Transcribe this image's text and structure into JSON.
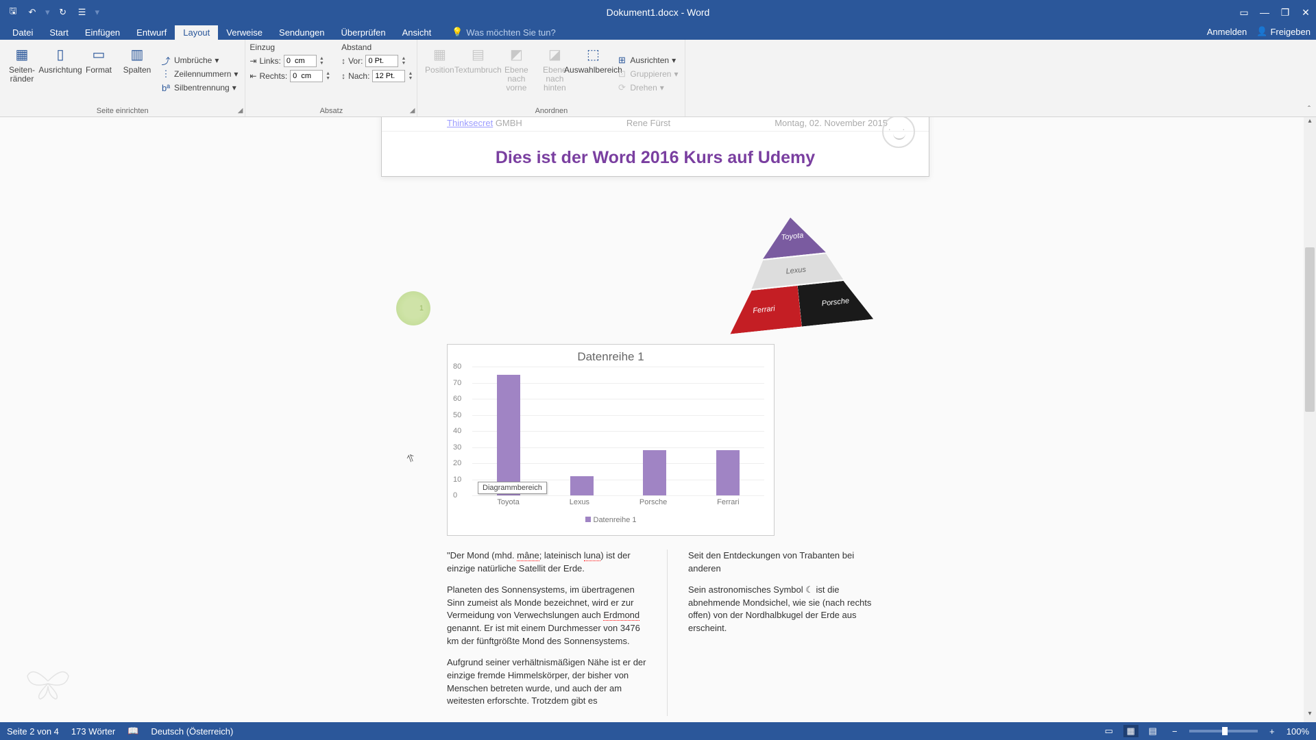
{
  "titlebar": {
    "title": "Dokument1.docx - Word"
  },
  "qat": {
    "save": "💾",
    "undo": "↶",
    "redo": "↻",
    "touch": "👆"
  },
  "tabs": {
    "datei": "Datei",
    "start": "Start",
    "einfuegen": "Einfügen",
    "entwurf": "Entwurf",
    "layout": "Layout",
    "verweise": "Verweise",
    "sendungen": "Sendungen",
    "ueberpruefen": "Überprüfen",
    "ansicht": "Ansicht"
  },
  "tellme": {
    "placeholder": "Was möchten Sie tun?"
  },
  "account": {
    "signin": "Anmelden",
    "share": "Freigeben"
  },
  "ribbon": {
    "seite": {
      "group": "Seite einrichten",
      "margins": "Seiten-\nränder",
      "orientation": "Ausrichtung",
      "size": "Format",
      "columns": "Spalten",
      "breaks": "Umbrüche",
      "linenumbers": "Zeilennummern",
      "hyphen": "Silbentrennung"
    },
    "absatz": {
      "group": "Absatz",
      "einzug": "Einzug",
      "abstand": "Abstand",
      "links": "Links:",
      "links_val": "0  cm",
      "rechts": "Rechts:",
      "rechts_val": "0  cm",
      "vor": "Vor:",
      "vor_val": "0 Pt.",
      "nach": "Nach:",
      "nach_val": "12 Pt."
    },
    "anordnen": {
      "group": "Anordnen",
      "position": "Position",
      "textwrap": "Textumbruch",
      "forward": "Ebene nach\nvorne",
      "backward": "Ebene nach\nhinten",
      "selection": "Auswahlbereich",
      "align": "Ausrichten",
      "group_objs": "Gruppieren",
      "rotate": "Drehen"
    }
  },
  "doc": {
    "header_left_link": "Thinksecret",
    "header_left_rest": " GMBH",
    "header_center": "Rene Fürst",
    "header_right": "Montag, 02. November 2015",
    "title": "Dies ist der Word 2016 Kurs auf Udemy",
    "pyramid": {
      "l1": "Toyota",
      "l2": "Lexus",
      "l3a": "Ferrari",
      "l3b": "Porsche"
    },
    "tooltip": "Diagrammbereich",
    "marker": "1",
    "para1a": "\"Der Mond (mhd. ",
    "para1_err1": "mâne",
    "para1b": "; lateinisch ",
    "para1_err2": "luna",
    "para1c": ") ist der einzige natürliche Satellit der Erde.",
    "para2a": "Planeten des Sonnensystems, im übertragenen Sinn zumeist als Monde bezeichnet, wird er zur Vermeidung von Verwechslungen auch ",
    "para2_err": "Erdmond",
    "para2b": " genannt. Er ist mit einem Durchmesser von 3476 km der fünftgrößte Mond des Sonnensystems.",
    "para3": "Aufgrund seiner verhältnismäßigen Nähe ist er der einzige fremde Himmelskörper, der bisher von Menschen betreten wurde, und auch der am weitesten erforschte. Trotzdem gibt es",
    "para_r1": "Seit den Entdeckungen von Trabanten bei anderen",
    "para_r2": "Sein astronomisches Symbol ☾ ist die abnehmende Mondsichel, wie sie (nach rechts offen) von der Nordhalbkugel der Erde aus erscheint."
  },
  "chart_data": {
    "type": "bar",
    "title": "Datenreihe 1",
    "ylim": [
      0,
      80
    ],
    "yticks": [
      0,
      10,
      20,
      30,
      40,
      50,
      60,
      70,
      80
    ],
    "categories": [
      "Toyota",
      "Lexus",
      "Porsche",
      "Ferrari"
    ],
    "values": [
      75,
      12,
      28,
      28
    ],
    "legend": "Datenreihe 1"
  },
  "status": {
    "page": "Seite 2 von 4",
    "words": "173 Wörter",
    "lang": "Deutsch (Österreich)",
    "zoom": "100%"
  }
}
